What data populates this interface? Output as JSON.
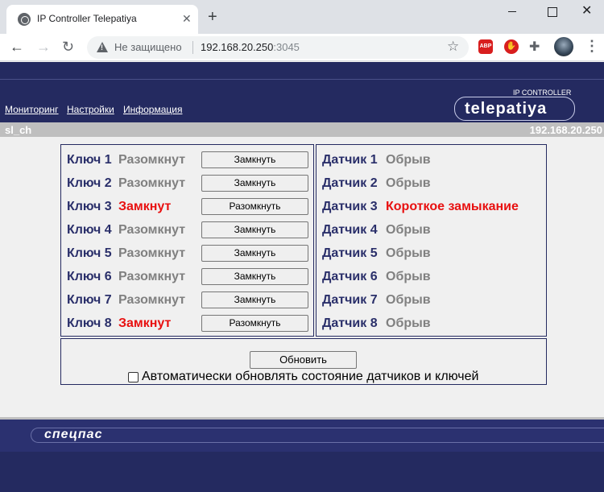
{
  "browser": {
    "tab_title": "IP Controller Telepatiya",
    "new_tab": "+",
    "security_label": "Не защищено",
    "url_host": "192.168.20.250",
    "url_port": ":3045"
  },
  "header": {
    "menu": [
      {
        "label": "Мониторинг"
      },
      {
        "label": "Настройки"
      },
      {
        "label": "Информация"
      }
    ],
    "product_label": "IP CONTROLLER",
    "logo_text": "telepatiya"
  },
  "infobar": {
    "device_name": "sl_ch",
    "ip": "192.168.20.250"
  },
  "keys": [
    {
      "name": "Ключ 1",
      "state": "Разомкнут",
      "state_color": "#808080",
      "button": "Замкнуть"
    },
    {
      "name": "Ключ 2",
      "state": "Разомкнут",
      "state_color": "#808080",
      "button": "Замкнуть"
    },
    {
      "name": "Ключ 3",
      "state": "Замкнут",
      "state_color": "#e81010",
      "button": "Разомкнуть"
    },
    {
      "name": "Ключ 4",
      "state": "Разомкнут",
      "state_color": "#808080",
      "button": "Замкнуть"
    },
    {
      "name": "Ключ 5",
      "state": "Разомкнут",
      "state_color": "#808080",
      "button": "Замкнуть"
    },
    {
      "name": "Ключ 6",
      "state": "Разомкнут",
      "state_color": "#808080",
      "button": "Замкнуть"
    },
    {
      "name": "Ключ 7",
      "state": "Разомкнут",
      "state_color": "#808080",
      "button": "Замкнуть"
    },
    {
      "name": "Ключ 8",
      "state": "Замкнут",
      "state_color": "#e81010",
      "button": "Разомкнуть"
    }
  ],
  "sensors": [
    {
      "name": "Датчик 1",
      "state": "Обрыв",
      "state_color": "#808080"
    },
    {
      "name": "Датчик 2",
      "state": "Обрыв",
      "state_color": "#808080"
    },
    {
      "name": "Датчик 3",
      "state": "Короткое замыкание",
      "state_color": "#e81010"
    },
    {
      "name": "Датчик 4",
      "state": "Обрыв",
      "state_color": "#808080"
    },
    {
      "name": "Датчик 5",
      "state": "Обрыв",
      "state_color": "#808080"
    },
    {
      "name": "Датчик 6",
      "state": "Обрыв",
      "state_color": "#808080"
    },
    {
      "name": "Датчик 7",
      "state": "Обрыв",
      "state_color": "#808080"
    },
    {
      "name": "Датчик 8",
      "state": "Обрыв",
      "state_color": "#808080"
    }
  ],
  "refresh": {
    "button": "Обновить",
    "auto_checked": false,
    "auto_label": "Автоматически обновлять состояние датчиков и ключей"
  },
  "footer": {
    "logo_text": "спецпас"
  },
  "colors": {
    "header_bg": "#242a60",
    "on_state": "#e81010",
    "off_state": "#808080",
    "label": "#2a2f6a"
  }
}
